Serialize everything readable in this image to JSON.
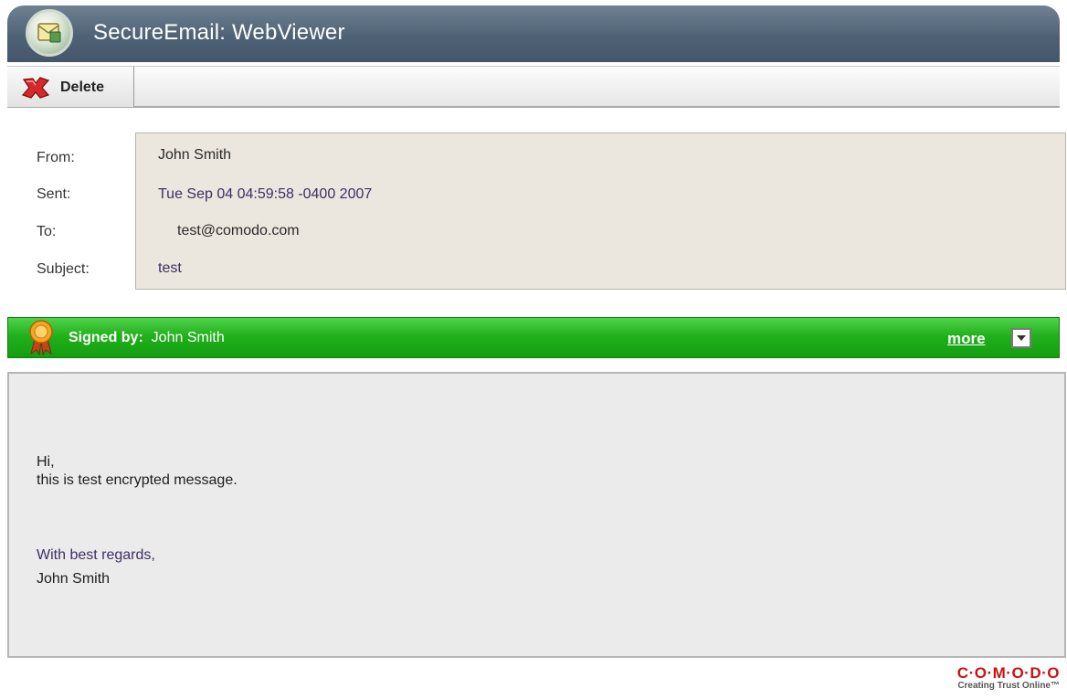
{
  "window": {
    "title": "SecureEmail: WebViewer"
  },
  "toolbar": {
    "delete_label": "Delete"
  },
  "header": {
    "fields": [
      {
        "label": "From:",
        "value": "John Smith"
      },
      {
        "label": "Sent:",
        "value": "Tue Sep 04 04:59:58 -0400 2007"
      },
      {
        "label": "To:",
        "value": "test@comodo.com"
      },
      {
        "label": "Subject:",
        "value": "test"
      }
    ]
  },
  "signature": {
    "prefix": "Signed by:",
    "signer": "John Smith",
    "more_label": "more",
    "bar_color": "#22b01d"
  },
  "message": {
    "lines": [
      "Hi,",
      "this is test encrypted message.",
      "With best regards,",
      "John Smith"
    ]
  },
  "logo": {
    "name": "C·O·M·O·D·O",
    "tagline": "Creating Trust Online™",
    "color": "#cc1111"
  },
  "icons": {
    "app": "secure-email-icon",
    "delete": "delete-x-icon",
    "signer": "award-ribbon-icon",
    "toggle": "chevron-down-icon"
  }
}
